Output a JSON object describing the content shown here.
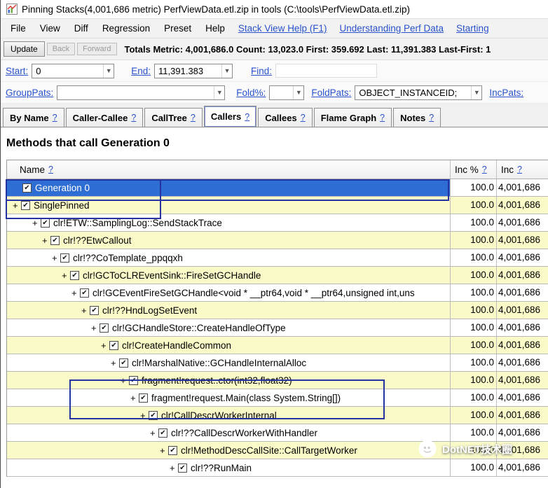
{
  "titlebar": {
    "title": "Pinning Stacks(4,001,686 metric) PerfViewData.etl.zip in tools (C:\\tools\\PerfViewData.etl.zip)"
  },
  "menu": {
    "items": [
      "File",
      "View",
      "Diff",
      "Regression",
      "Preset",
      "Help"
    ],
    "links": [
      "Stack View Help (F1)",
      "Understanding Perf Data",
      "Starting"
    ]
  },
  "toolbar": {
    "update_label": "Update",
    "back_label": "Back",
    "forward_label": "Forward",
    "totals": "Totals Metric: 4,001,686.0  Count: 13,023.0  First: 359.692 Last: 11,391.383  Last-First: 1"
  },
  "filters": {
    "start_label": "Start:",
    "start_value": "0",
    "end_label": "End:",
    "end_value": "11,391.383",
    "find_label": "Find:",
    "find_value": "",
    "grouppats_label": "GroupPats:",
    "grouppats_value": "",
    "foldpct_label": "Fold%:",
    "foldpct_value": "",
    "foldpats_label": "FoldPats:",
    "foldpats_value": "OBJECT_INSTANCEID;",
    "incpats_label": "IncPats:"
  },
  "tabs": [
    {
      "label": "By Name",
      "help": "?"
    },
    {
      "label": "Caller-Callee",
      "help": "?"
    },
    {
      "label": "CallTree",
      "help": "?"
    },
    {
      "label": "Callers",
      "help": "?"
    },
    {
      "label": "Callees",
      "help": "?"
    },
    {
      "label": "Flame Graph",
      "help": "?"
    },
    {
      "label": "Notes",
      "help": "?"
    }
  ],
  "heading": "Methods that call Generation 0",
  "table": {
    "columns": [
      {
        "label": "Name",
        "help": "?"
      },
      {
        "label": "Inc %",
        "help": "?"
      },
      {
        "label": "Inc",
        "help": "?"
      }
    ],
    "rows": [
      {
        "name": "Generation 0",
        "depth": 1,
        "plus": false,
        "selected": true,
        "shade": "white",
        "inc_pct": "100.0",
        "inc": "4,001,686"
      },
      {
        "name": "SinglePinned",
        "depth": 0,
        "plus": true,
        "selected": false,
        "shade": "yellow",
        "inc_pct": "100.0",
        "inc": "4,001,686"
      },
      {
        "name": "clr!ETW::SamplingLog::SendStackTrace",
        "depth": 2,
        "plus": true,
        "selected": false,
        "shade": "white",
        "inc_pct": "100.0",
        "inc": "4,001,686"
      },
      {
        "name": "clr!??EtwCallout",
        "depth": 3,
        "plus": true,
        "selected": false,
        "shade": "yellow",
        "inc_pct": "100.0",
        "inc": "4,001,686"
      },
      {
        "name": "clr!??CoTemplate_ppqqxh",
        "depth": 4,
        "plus": true,
        "selected": false,
        "shade": "white",
        "inc_pct": "100.0",
        "inc": "4,001,686"
      },
      {
        "name": "clr!GCToCLREventSink::FireSetGCHandle",
        "depth": 5,
        "plus": true,
        "selected": false,
        "shade": "yellow",
        "inc_pct": "100.0",
        "inc": "4,001,686"
      },
      {
        "name": "clr!GCEventFireSetGCHandle<void * __ptr64,void * __ptr64,unsigned int,uns",
        "depth": 6,
        "plus": true,
        "selected": false,
        "shade": "white",
        "inc_pct": "100.0",
        "inc": "4,001,686"
      },
      {
        "name": "clr!??HndLogSetEvent",
        "depth": 7,
        "plus": true,
        "selected": false,
        "shade": "yellow",
        "inc_pct": "100.0",
        "inc": "4,001,686"
      },
      {
        "name": "clr!GCHandleStore::CreateHandleOfType",
        "depth": 8,
        "plus": true,
        "selected": false,
        "shade": "white",
        "inc_pct": "100.0",
        "inc": "4,001,686"
      },
      {
        "name": "clr!CreateHandleCommon",
        "depth": 9,
        "plus": true,
        "selected": false,
        "shade": "yellow",
        "inc_pct": "100.0",
        "inc": "4,001,686"
      },
      {
        "name": "clr!MarshalNative::GCHandleInternalAlloc",
        "depth": 10,
        "plus": true,
        "selected": false,
        "shade": "white",
        "inc_pct": "100.0",
        "inc": "4,001,686"
      },
      {
        "name": "fragment!request..ctor(int32,float32)",
        "depth": 11,
        "plus": true,
        "selected": false,
        "shade": "yellow",
        "inc_pct": "100.0",
        "inc": "4,001,686"
      },
      {
        "name": "fragment!request.Main(class System.String[])",
        "depth": 12,
        "plus": true,
        "selected": false,
        "shade": "white",
        "inc_pct": "100.0",
        "inc": "4,001,686"
      },
      {
        "name": "clr!CallDescrWorkerInternal",
        "depth": 13,
        "plus": true,
        "selected": false,
        "shade": "yellow",
        "inc_pct": "100.0",
        "inc": "4,001,686"
      },
      {
        "name": "clr!??CallDescrWorkerWithHandler",
        "depth": 14,
        "plus": true,
        "selected": false,
        "shade": "white",
        "inc_pct": "100.0",
        "inc": "4,001,686"
      },
      {
        "name": "clr!MethodDescCallSite::CallTargetWorker",
        "depth": 15,
        "plus": true,
        "selected": false,
        "shade": "yellow",
        "inc_pct": "100.0",
        "inc": "4,001,686"
      },
      {
        "name": "clr!??RunMain",
        "depth": 16,
        "plus": true,
        "selected": false,
        "shade": "white",
        "inc_pct": "100.0",
        "inc": "4,001,686"
      }
    ]
  },
  "watermark": {
    "text": "DotNET技术圈"
  },
  "colors": {
    "selection_blue": "#2E6DD3",
    "row_yellow": "#FAFAC8",
    "link_blue": "#2952CC",
    "annotation_navy": "#2433A0"
  }
}
